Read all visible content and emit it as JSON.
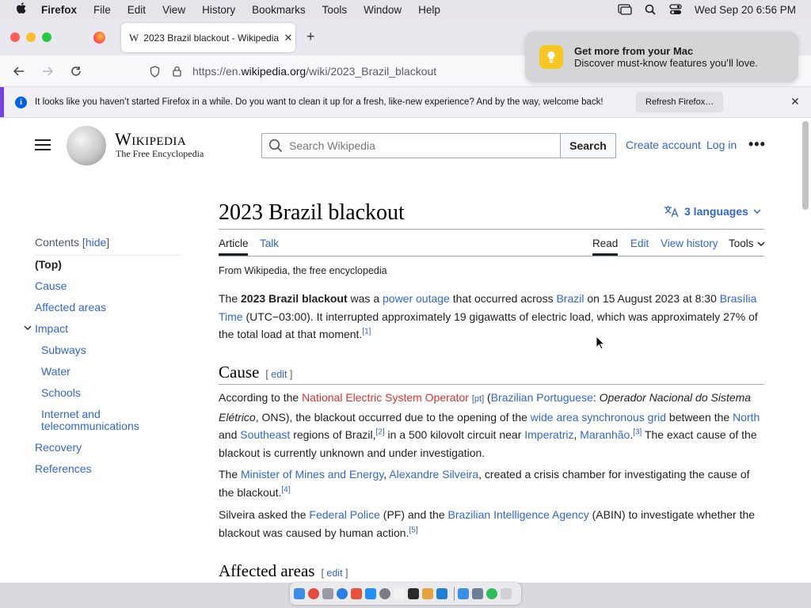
{
  "menubar": {
    "app": "Firefox",
    "items": [
      "File",
      "Edit",
      "View",
      "History",
      "Bookmarks",
      "Tools",
      "Window",
      "Help"
    ],
    "clock": "Wed Sep 20  6:56 PM"
  },
  "tab": {
    "title": "2023 Brazil blackout - Wikipedia",
    "favicon": "W"
  },
  "url": {
    "prefix": "https://en.",
    "host": "wikipedia.org",
    "path": "/wiki/2023_Brazil_blackout"
  },
  "notification": {
    "title": "Get more from your Mac",
    "body": "Discover must-know features you’ll love."
  },
  "infobar": {
    "message": "It looks like you haven’t started Firefox in a while. Do you want to clean it up for a fresh, like-new experience? And by the way, welcome back!",
    "button": "Refresh Firefox…"
  },
  "wiki": {
    "wordmark": "Wikipedia",
    "tagline": "The Free Encyclopedia",
    "search_placeholder": "Search Wikipedia",
    "search_button": "Search",
    "create_account": "Create account",
    "login": "Log in"
  },
  "article": {
    "title": "2023 Brazil blackout",
    "languages": "3 languages",
    "tabs": {
      "article": "Article",
      "talk": "Talk",
      "read": "Read",
      "edit": "Edit",
      "history": "View history",
      "tools": "Tools"
    },
    "from": "From Wikipedia, the free encyclopedia",
    "edit_label": "edit",
    "sections": {
      "cause": "Cause",
      "affected": "Affected areas"
    }
  },
  "toc": {
    "heading": "Contents",
    "hide": "hide",
    "items": [
      "(Top)",
      "Cause",
      "Affected areas",
      "Impact",
      "Subways",
      "Water",
      "Schools",
      "Internet and telecommunications",
      "Recovery",
      "References"
    ]
  },
  "paragraphs": {
    "intro": {
      "t1": "The ",
      "b1": "2023 Brazil blackout",
      "t2": " was a ",
      "l1": "power outage",
      "t3": " that occurred across ",
      "l2": "Brazil",
      "t4": " on 15 August 2023 at 8:30 ",
      "l3": "Brasília Time",
      "t5": " (UTC−03:00). It interrupted approximately 19 gigawatts of electric load, which was approximately 27% of the total load at that moment.",
      "r1": "[1]"
    },
    "cause1": {
      "t1": "According to the ",
      "l1": "National Electric System Operator",
      "pt": "pt",
      "t2": " (",
      "l2": "Brazilian Portuguese",
      "t3": ": ",
      "i1": "Operador Nacional do Sistema Elétrico",
      "t4": ", ONS), the blackout occurred due to the opening of the ",
      "l3": "wide area synchronous grid",
      "t5": " between the ",
      "l4": "North",
      "t6": " and ",
      "l5": "Southeast",
      "t7": " regions of Brazil,",
      "r2": "[2]",
      "t8": " in a 500 kilovolt circuit near ",
      "l6": "Imperatriz",
      "t9": ", ",
      "l7": "Maranhão",
      "t10": ".",
      "r3": "[3]",
      "t11": " The exact cause of the blackout is currently unknown and under investigation."
    },
    "cause2": {
      "t1": "The ",
      "l1": "Minister of Mines and Energy",
      "t2": ", ",
      "l2": "Alexandre Silveira",
      "t3": ", created a crisis chamber for investigating the cause of the blackout.",
      "r4": "[4]"
    },
    "cause3": {
      "t1": "Silveira asked the ",
      "l1": "Federal Police",
      "t2": " (PF) and the ",
      "l2": "Brazilian Intelligence Agency",
      "t3": " (ABIN) to investigate whether the blackout was caused by human action.",
      "r5": "[5]"
    }
  },
  "colors": {
    "link": "#3366cc",
    "redlink": "#d73333",
    "accent": "#7542e5"
  }
}
